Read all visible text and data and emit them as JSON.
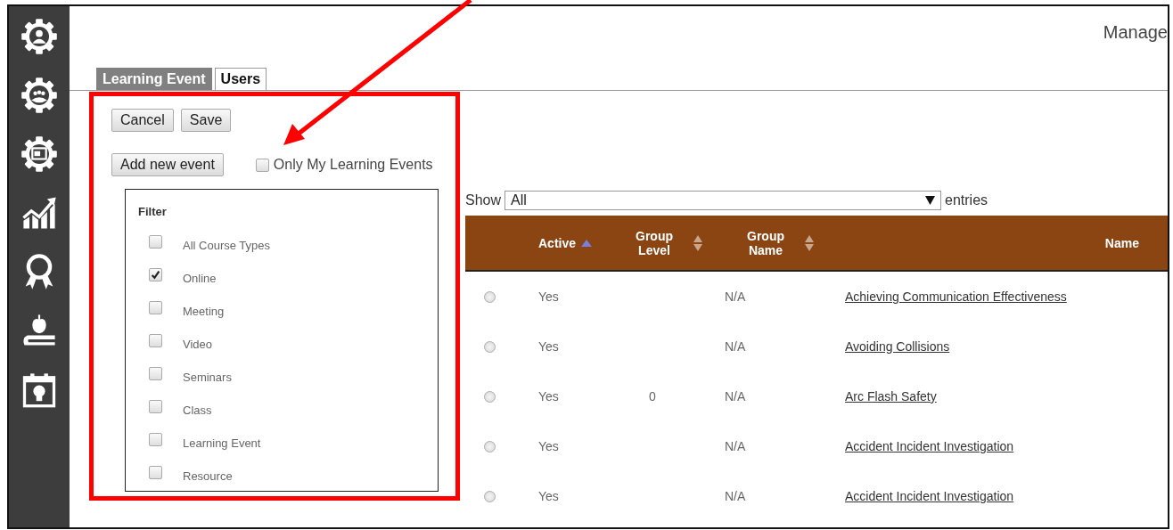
{
  "header": {
    "title": "Manage"
  },
  "tabs": [
    {
      "label": "Learning Event",
      "selected": true
    },
    {
      "label": "Users",
      "selected": false
    }
  ],
  "actions": [
    "Cancel",
    "Save"
  ],
  "add_button": "Add new event",
  "only_mine": {
    "label": "Only My Learning Events",
    "checked": false
  },
  "filter": {
    "title": "Filter",
    "options": [
      {
        "label": "All Course Types",
        "checked": false
      },
      {
        "label": "Online",
        "checked": true
      },
      {
        "label": "Meeting",
        "checked": false
      },
      {
        "label": "Video",
        "checked": false
      },
      {
        "label": "Seminars",
        "checked": false
      },
      {
        "label": "Class",
        "checked": false
      },
      {
        "label": "Learning Event",
        "checked": false
      },
      {
        "label": "Resource",
        "checked": false
      }
    ]
  },
  "length_menu": {
    "prefix": "Show",
    "value": "All",
    "suffix": "entries"
  },
  "table": {
    "columns": [
      {
        "label": "Active",
        "sorted": true
      },
      {
        "label": "Group Level",
        "sorted": false
      },
      {
        "label": "Group Name",
        "sorted": false
      },
      {
        "label": "Name"
      }
    ],
    "rows": [
      {
        "selected": false,
        "active": "Yes",
        "group_name": "N/A",
        "name": "Achieving Communication Effectiveness"
      },
      {
        "selected": false,
        "active": "Yes",
        "group_name": "N/A",
        "name": "Avoiding Collisions"
      },
      {
        "selected": false,
        "active": "Yes",
        "group_level": "0",
        "group_name": "N/A",
        "name": "Arc Flash Safety"
      },
      {
        "selected": false,
        "active": "Yes",
        "group_name": "N/A",
        "name": "Accident Incident Investigation"
      },
      {
        "selected": false,
        "active": "Yes",
        "group_name": "N/A",
        "name": "Accident Incident Investigation"
      }
    ]
  }
}
